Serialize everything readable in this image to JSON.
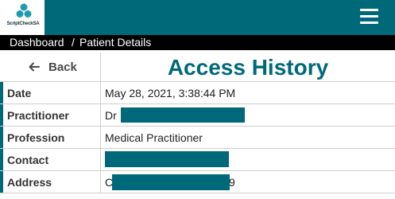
{
  "app": {
    "logo_text": "ScriptCheckSA",
    "menu_icon": "hamburger-menu-icon",
    "brand_color": "#006979"
  },
  "breadcrumb": {
    "home": "Dashboard",
    "separator": "/",
    "current": "Patient Details"
  },
  "header": {
    "back_label": "Back",
    "back_icon": "arrow-left-icon",
    "title": "Access History"
  },
  "details": {
    "date": {
      "label": "Date",
      "value": "May 28, 2021, 3:38:44 PM"
    },
    "practitioner": {
      "label": "Practitioner",
      "value_prefix": "Dr"
    },
    "profession": {
      "label": "Profession",
      "value": "Medical Practitioner"
    },
    "contact": {
      "label": "Contact"
    },
    "address": {
      "label": "Address",
      "value_prefix": "C",
      "value_suffix": "9"
    }
  }
}
